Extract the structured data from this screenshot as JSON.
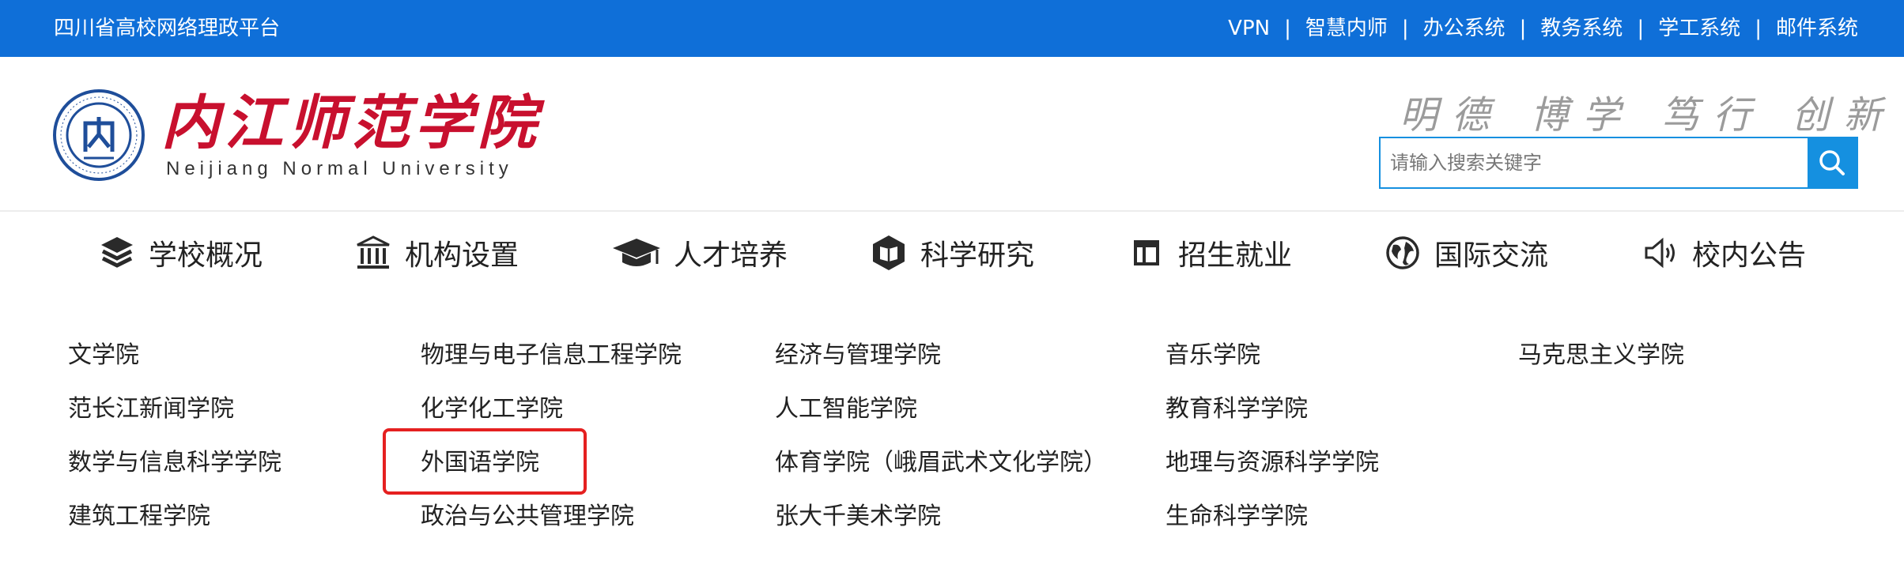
{
  "topbar": {
    "platform": "四川省高校网络理政平台",
    "links": [
      "VPN",
      "智慧内师",
      "办公系统",
      "教务系统",
      "学工系统",
      "邮件系统"
    ]
  },
  "header": {
    "logo_cn": "内江师范学院",
    "logo_en": "Neijiang Normal University",
    "motto": "明德 博学 笃行 创新",
    "search_placeholder": "请输入搜索关键字",
    "search_value": ""
  },
  "nav": [
    {
      "label": "学校概况",
      "icon": "layers-icon"
    },
    {
      "label": "机构设置",
      "icon": "institution-icon"
    },
    {
      "label": "人才培养",
      "icon": "graduation-cap-icon"
    },
    {
      "label": "科学研究",
      "icon": "book-hexagon-icon"
    },
    {
      "label": "招生就业",
      "icon": "layout-icon"
    },
    {
      "label": "国际交流",
      "icon": "globe-icon"
    },
    {
      "label": "校内公告",
      "icon": "speaker-icon"
    }
  ],
  "colleges": [
    [
      "文学院",
      "范长江新闻学院",
      "数学与信息科学学院",
      "建筑工程学院"
    ],
    [
      "物理与电子信息工程学院",
      "化学化工学院",
      "外国语学院",
      "政治与公共管理学院"
    ],
    [
      "经济与管理学院",
      "人工智能学院",
      "体育学院（峨眉武术文化学院）",
      "张大千美术学院"
    ],
    [
      "音乐学院",
      "教育科学学院",
      "地理与资源科学学院",
      "生命科学学院"
    ],
    [
      "马克思主义学院"
    ]
  ],
  "colors": {
    "topbar": "#0f6fd8",
    "brand_red": "#c8102e",
    "search_blue": "#1590e0",
    "highlight": "#e52020"
  }
}
